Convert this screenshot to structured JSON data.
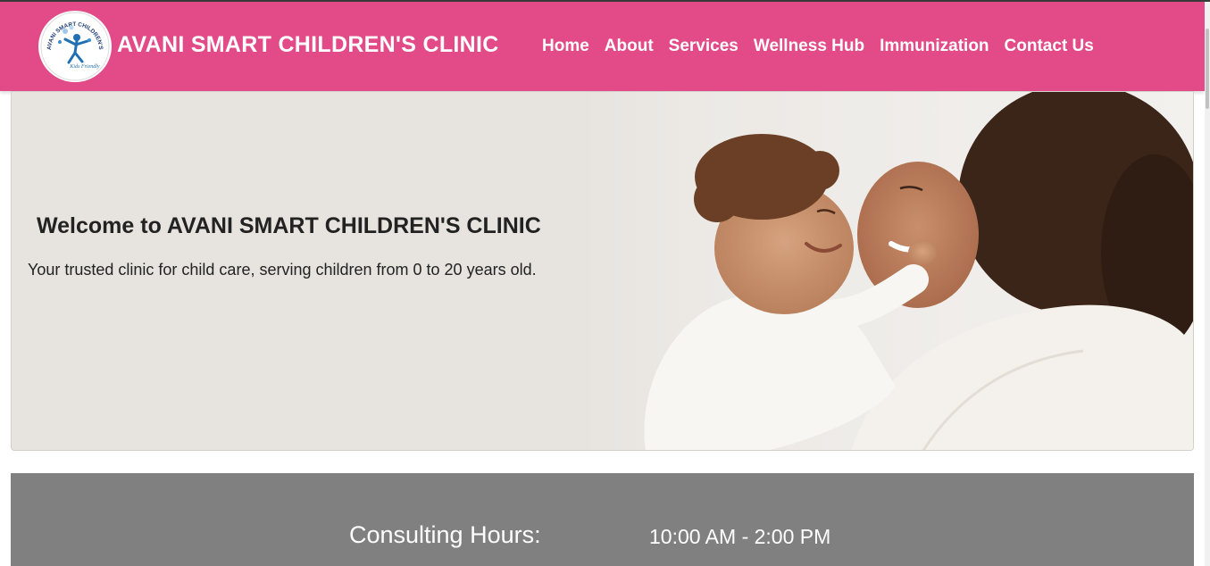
{
  "header": {
    "logo": {
      "ring_text": "AVANI SMART CHILDREN'S CLINIC",
      "tagline": "Kids Friendly",
      "accent": "#1f6fb2"
    },
    "brand": "AVANI SMART CHILDREN'S CLINIC",
    "nav": [
      "Home",
      "About",
      "Services",
      "Wellness Hub",
      "Immunization",
      "Contact Us"
    ],
    "color": "#e34a88"
  },
  "hero": {
    "title": "Welcome to AVANI SMART CHILDREN'S CLINIC",
    "subtitle": "Your trusted clinic for child care, serving children from 0 to 20 years old.",
    "image_icon": "mother-and-baby-photo"
  },
  "hours": {
    "label": "Consulting Hours:",
    "value": "10:00 AM - 2:00 PM",
    "color": "#808080"
  }
}
